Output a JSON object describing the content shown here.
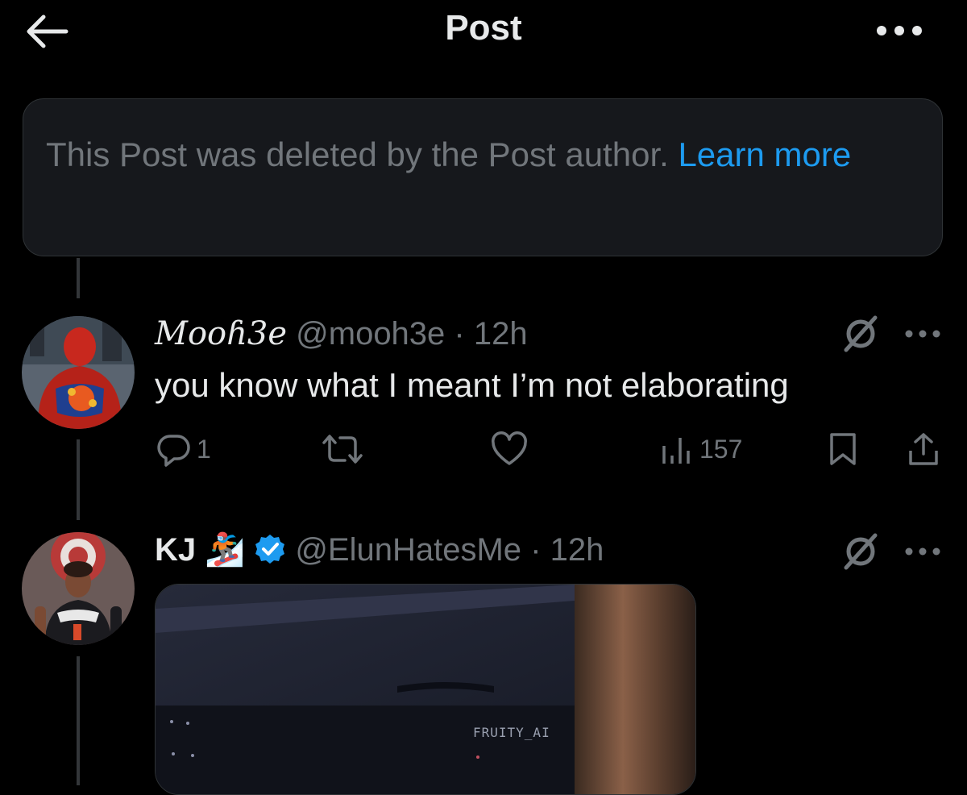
{
  "header": {
    "title": "Post"
  },
  "deleted_notice": {
    "text": "This Post was deleted by the Post author.",
    "link_text": "Learn more"
  },
  "tweets": [
    {
      "display_name": "Mooɦ3e",
      "handle": "@mooh3e",
      "separator": "·",
      "time": "12h",
      "text": "you know what I meant I’m not elaborating",
      "reply_count": "1",
      "view_count": "157",
      "avatar_icon": "spiderman-avatar"
    },
    {
      "display_name": "KJ",
      "emoji": "🏂",
      "handle": "@ElunHatesMe",
      "separator": "·",
      "time": "12h",
      "verified": true,
      "media_watermark": "FRUITY_AI",
      "avatar_icon": "basketball-player-avatar"
    }
  ],
  "colors": {
    "background": "#000000",
    "text": "#e7e9ea",
    "muted": "#71767b",
    "accent": "#1d9bf0",
    "border": "#2f3336"
  }
}
